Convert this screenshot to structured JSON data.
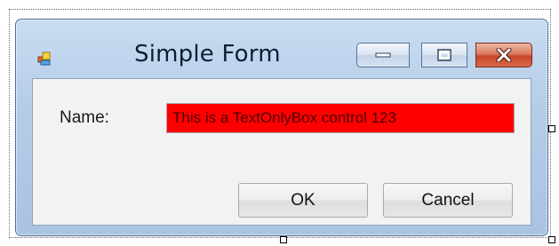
{
  "window": {
    "title": "Simple Form"
  },
  "form": {
    "name_label": "Name:",
    "name_value": "This is a TextOnlyBox control 123",
    "textbox_background": "#ff0000"
  },
  "buttons": {
    "ok_label": "OK",
    "cancel_label": "Cancel"
  },
  "caption_buttons": {
    "minimize_icon": "minimize-icon",
    "maximize_icon": "maximize-icon",
    "close_icon": "close-icon"
  },
  "colors": {
    "frame": "#b6cde8",
    "close_button": "#c8452b"
  }
}
